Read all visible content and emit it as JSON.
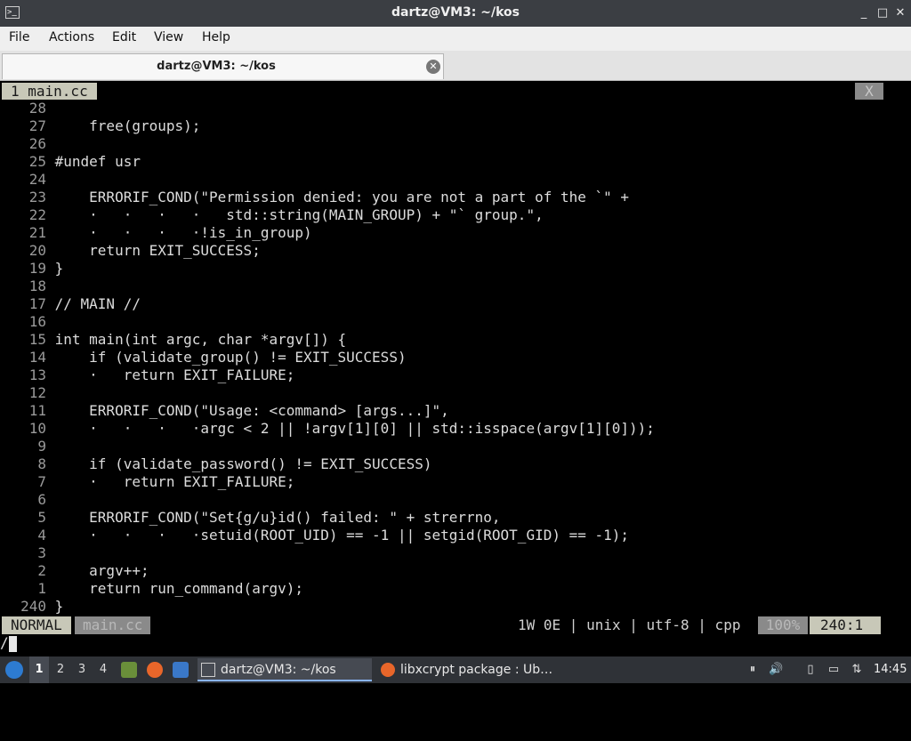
{
  "window": {
    "title": "dartz@VM3: ~/kos",
    "minimize": "_",
    "maximize": "□",
    "close": "✕"
  },
  "menu": [
    "File",
    "Actions",
    "Edit",
    "View",
    "Help"
  ],
  "tab": {
    "label": "dartz@VM3: ~/kos",
    "close": "✕"
  },
  "vim": {
    "tabline": {
      "active": "1 main.cc",
      "close": "X"
    },
    "lines": [
      {
        "n": "28",
        "t": ""
      },
      {
        "n": "27",
        "t": "    free(groups);"
      },
      {
        "n": "26",
        "t": ""
      },
      {
        "n": "25",
        "t": "#undef usr"
      },
      {
        "n": "24",
        "t": ""
      },
      {
        "n": "23",
        "t": "    ERRORIF_COND(\"Permission denied: you are not a part of the `\" +"
      },
      {
        "n": "22",
        "t": "    ·   ·   ·   ·   std::string(MAIN_GROUP) + \"` group.\","
      },
      {
        "n": "21",
        "t": "    ·   ·   ·   ·!is_in_group)"
      },
      {
        "n": "20",
        "t": "    return EXIT_SUCCESS;"
      },
      {
        "n": "19",
        "t": "}"
      },
      {
        "n": "18",
        "t": ""
      },
      {
        "n": "17",
        "t": "// MAIN //"
      },
      {
        "n": "16",
        "t": ""
      },
      {
        "n": "15",
        "t": "int main(int argc, char *argv[]) {"
      },
      {
        "n": "14",
        "t": "    if (validate_group() != EXIT_SUCCESS)"
      },
      {
        "n": "13",
        "t": "    ·   return EXIT_FAILURE;"
      },
      {
        "n": "12",
        "t": ""
      },
      {
        "n": "11",
        "t": "    ERRORIF_COND(\"Usage: <command> [args...]\","
      },
      {
        "n": "10",
        "t": "    ·   ·   ·   ·argc < 2 || !argv[1][0] || std::isspace(argv[1][0]));"
      },
      {
        "n": "9",
        "t": ""
      },
      {
        "n": "8",
        "t": "    if (validate_password() != EXIT_SUCCESS)"
      },
      {
        "n": "7",
        "t": "    ·   return EXIT_FAILURE;"
      },
      {
        "n": "6",
        "t": ""
      },
      {
        "n": "5",
        "t": "    ERRORIF_COND(\"Set{g/u}id() failed: \" + strerrno,"
      },
      {
        "n": "4",
        "t": "    ·   ·   ·   ·setuid(ROOT_UID) == -1 || setgid(ROOT_GID) == -1);"
      },
      {
        "n": "3",
        "t": ""
      },
      {
        "n": "2",
        "t": "    argv++;"
      },
      {
        "n": "1",
        "t": "    return run_command(argv);"
      },
      {
        "n": "240",
        "t": "}"
      }
    ],
    "status": {
      "mode": "NORMAL",
      "file": "main.cc",
      "info": "1W 0E | unix | utf-8 | cpp",
      "percent": "100%",
      "position": "240:1"
    },
    "cmdline": "/"
  },
  "taskbar": {
    "workspaces": [
      "1",
      "2",
      "3",
      "4"
    ],
    "tasks": [
      {
        "label": "dartz@VM3: ~/kos",
        "icon": "terminal-icon"
      },
      {
        "label": "libxcrypt package : Ub…",
        "icon": "firefox-icon"
      }
    ],
    "clock": "14:45"
  }
}
